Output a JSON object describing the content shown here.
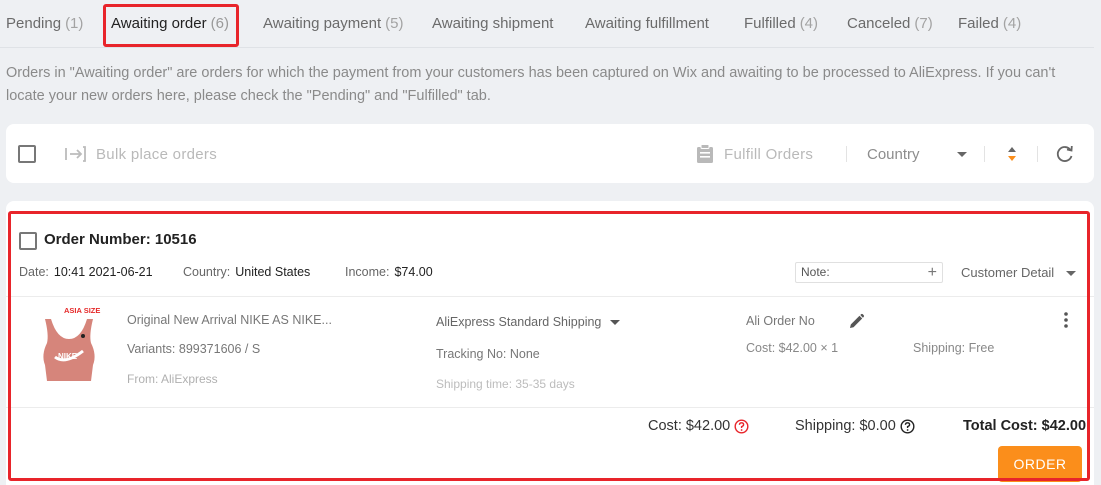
{
  "tabs": [
    {
      "label": "Pending",
      "count": "(1)"
    },
    {
      "label": "Awaiting order",
      "count": "(6)"
    },
    {
      "label": "Awaiting payment",
      "count": "(5)"
    },
    {
      "label": "Awaiting shipment",
      "count": ""
    },
    {
      "label": "Awaiting fulfillment",
      "count": ""
    },
    {
      "label": "Fulfilled",
      "count": "(4)"
    },
    {
      "label": "Canceled",
      "count": "(7)"
    },
    {
      "label": "Failed",
      "count": "(4)"
    }
  ],
  "info_text": "Orders in \"Awaiting order\" are orders for which the payment from your customers has been captured on Wix and awaiting to be processed to AliExpress. If you can't locate your new orders here, please check the \"Pending\" and \"Fulfilled\" tab.",
  "toolbar": {
    "bulk_label": "Bulk place orders",
    "fulfill_label": "Fulfill Orders",
    "country_label": "Country"
  },
  "order": {
    "number_label": "Order Number: 10516",
    "date_label": "Date:",
    "date_value": "10:41 2021-06-21",
    "country_label": "Country:",
    "country_value": "United States",
    "income_label": "Income:",
    "income_value": "$74.00",
    "note_placeholder": "Note:",
    "customer_detail": "Customer Detail",
    "product": {
      "image_badge": "ASIA SIZE",
      "image_logo": "NIKE",
      "title": "Original New Arrival NIKE AS NIKE...",
      "variants": "Variants: 899371606 / S",
      "from": "From: AliExpress"
    },
    "shipping_method": "AliExpress Standard Shipping",
    "tracking": "Tracking No: None",
    "shipping_time": "Shipping time: 35-35 days",
    "ali_order_no": "Ali Order No",
    "cost_line": "Cost: $42.00 × 1",
    "shipping_free": "Shipping: Free",
    "summary_cost": "Cost: $42.00",
    "summary_shipping": "Shipping: $0.00",
    "summary_total": "Total Cost: $42.00",
    "order_button": "ORDER"
  },
  "colors": {
    "accent_orange": "#fb8e1b",
    "highlight_red": "#e8242a",
    "help_red": "#e8242a"
  }
}
